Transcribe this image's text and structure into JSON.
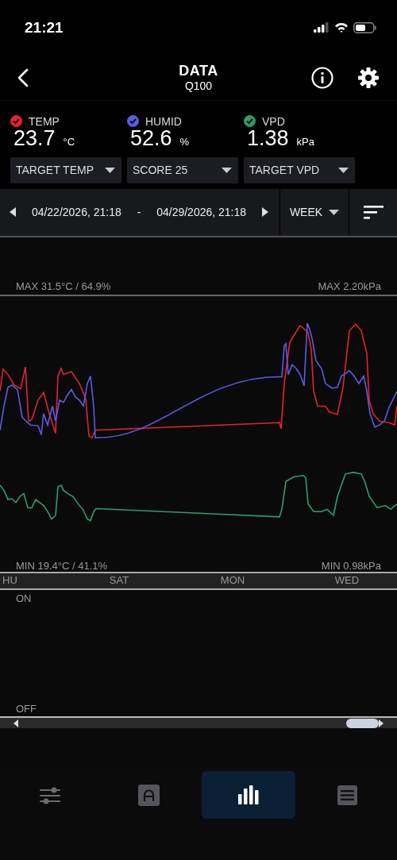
{
  "status_bar": {
    "time": "21:21"
  },
  "header": {
    "title": "DATA",
    "subtitle": "Q100"
  },
  "sensors": [
    {
      "label": "TEMP",
      "checked": true,
      "color": "#e8212f",
      "value": "23.7",
      "unit": "°C"
    },
    {
      "label": "HUMID",
      "checked": true,
      "color": "#5b5ce6",
      "value": "52.6",
      "unit": "%"
    },
    {
      "label": "VPD",
      "checked": true,
      "color": "#2e9e6a",
      "value": "1.38",
      "unit": "kPa"
    }
  ],
  "dropdowns": [
    "TARGET TEMP",
    "SCORE 25",
    "TARGET VPD"
  ],
  "range": {
    "start": "04/22/2026, 21:18",
    "separator": "-",
    "end": "04/29/2026, 21:18",
    "period": "WEEK"
  },
  "chart": {
    "max_left": "MAX 31.5°C / 64.9%",
    "max_right": "MAX 2.20kPa",
    "min_left": "MIN 19.4°C / 41.1%",
    "min_right": "MIN 0.98kPa",
    "days": [
      "HU",
      "SAT",
      "MON",
      "WED"
    ]
  },
  "state_chart": {
    "on_label": "ON",
    "off_label": "OFF"
  },
  "nav": [
    {
      "kind": "sliders",
      "selected": false
    },
    {
      "kind": "arch",
      "selected": false
    },
    {
      "kind": "bars",
      "selected": true
    },
    {
      "kind": "list",
      "selected": false
    }
  ]
}
